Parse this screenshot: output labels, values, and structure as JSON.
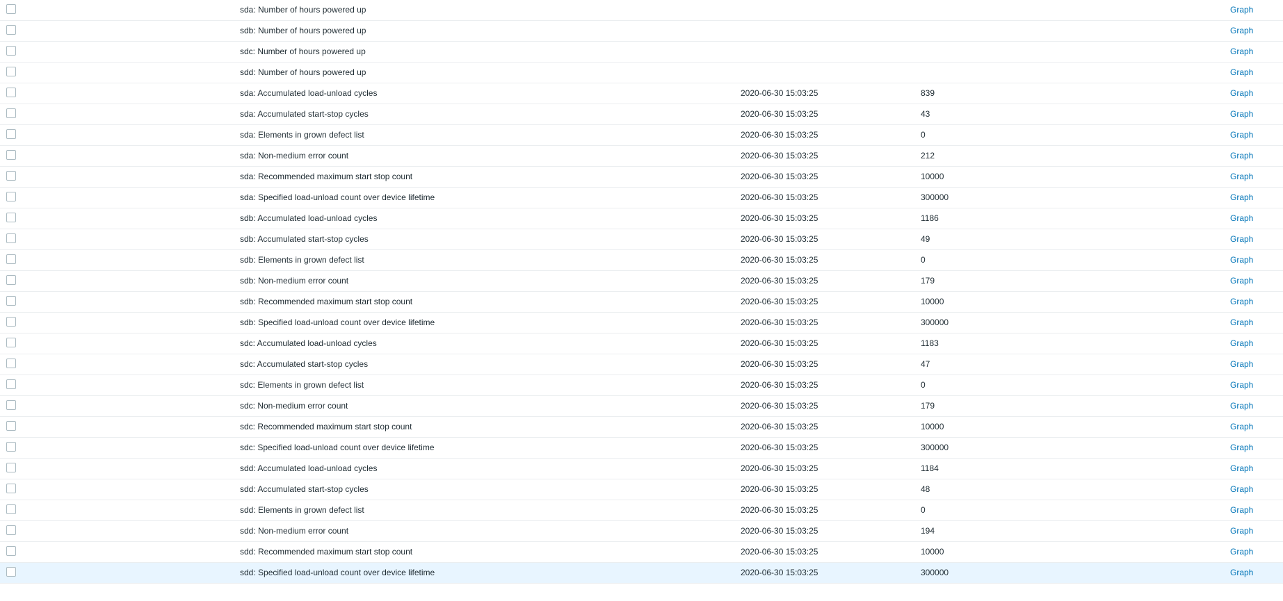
{
  "colors": {
    "link": "#0275b8",
    "row_border": "#ebeef0",
    "highlight_row": "#e8f5ff",
    "checkbox_border": "#acbbc2"
  },
  "rows": [
    {
      "name": "sda: Number of hours powered up",
      "last_check": "",
      "last_value": "",
      "action": "Graph"
    },
    {
      "name": "sdb: Number of hours powered up",
      "last_check": "",
      "last_value": "",
      "action": "Graph"
    },
    {
      "name": "sdc: Number of hours powered up",
      "last_check": "",
      "last_value": "",
      "action": "Graph"
    },
    {
      "name": "sdd: Number of hours powered up",
      "last_check": "",
      "last_value": "",
      "action": "Graph"
    },
    {
      "name": "sda: Accumulated load-unload cycles",
      "last_check": "2020-06-30 15:03:25",
      "last_value": "839",
      "action": "Graph"
    },
    {
      "name": "sda: Accumulated start-stop cycles",
      "last_check": "2020-06-30 15:03:25",
      "last_value": "43",
      "action": "Graph"
    },
    {
      "name": "sda: Elements in grown defect list",
      "last_check": "2020-06-30 15:03:25",
      "last_value": "0",
      "action": "Graph"
    },
    {
      "name": "sda: Non-medium error count",
      "last_check": "2020-06-30 15:03:25",
      "last_value": "212",
      "action": "Graph"
    },
    {
      "name": "sda: Recommended maximum start stop count",
      "last_check": "2020-06-30 15:03:25",
      "last_value": "10000",
      "action": "Graph"
    },
    {
      "name": "sda: Specified load-unload count over device lifetime",
      "last_check": "2020-06-30 15:03:25",
      "last_value": "300000",
      "action": "Graph"
    },
    {
      "name": "sdb: Accumulated load-unload cycles",
      "last_check": "2020-06-30 15:03:25",
      "last_value": "1186",
      "action": "Graph"
    },
    {
      "name": "sdb: Accumulated start-stop cycles",
      "last_check": "2020-06-30 15:03:25",
      "last_value": "49",
      "action": "Graph"
    },
    {
      "name": "sdb: Elements in grown defect list",
      "last_check": "2020-06-30 15:03:25",
      "last_value": "0",
      "action": "Graph"
    },
    {
      "name": "sdb: Non-medium error count",
      "last_check": "2020-06-30 15:03:25",
      "last_value": "179",
      "action": "Graph"
    },
    {
      "name": "sdb: Recommended maximum start stop count",
      "last_check": "2020-06-30 15:03:25",
      "last_value": "10000",
      "action": "Graph"
    },
    {
      "name": "sdb: Specified load-unload count over device lifetime",
      "last_check": "2020-06-30 15:03:25",
      "last_value": "300000",
      "action": "Graph"
    },
    {
      "name": "sdc: Accumulated load-unload cycles",
      "last_check": "2020-06-30 15:03:25",
      "last_value": "1183",
      "action": "Graph"
    },
    {
      "name": "sdc: Accumulated start-stop cycles",
      "last_check": "2020-06-30 15:03:25",
      "last_value": "47",
      "action": "Graph"
    },
    {
      "name": "sdc: Elements in grown defect list",
      "last_check": "2020-06-30 15:03:25",
      "last_value": "0",
      "action": "Graph"
    },
    {
      "name": "sdc: Non-medium error count",
      "last_check": "2020-06-30 15:03:25",
      "last_value": "179",
      "action": "Graph"
    },
    {
      "name": "sdc: Recommended maximum start stop count",
      "last_check": "2020-06-30 15:03:25",
      "last_value": "10000",
      "action": "Graph"
    },
    {
      "name": "sdc: Specified load-unload count over device lifetime",
      "last_check": "2020-06-30 15:03:25",
      "last_value": "300000",
      "action": "Graph"
    },
    {
      "name": "sdd: Accumulated load-unload cycles",
      "last_check": "2020-06-30 15:03:25",
      "last_value": "1184",
      "action": "Graph"
    },
    {
      "name": "sdd: Accumulated start-stop cycles",
      "last_check": "2020-06-30 15:03:25",
      "last_value": "48",
      "action": "Graph"
    },
    {
      "name": "sdd: Elements in grown defect list",
      "last_check": "2020-06-30 15:03:25",
      "last_value": "0",
      "action": "Graph"
    },
    {
      "name": "sdd: Non-medium error count",
      "last_check": "2020-06-30 15:03:25",
      "last_value": "194",
      "action": "Graph"
    },
    {
      "name": "sdd: Recommended maximum start stop count",
      "last_check": "2020-06-30 15:03:25",
      "last_value": "10000",
      "action": "Graph"
    },
    {
      "name": "sdd: Specified load-unload count over device lifetime",
      "last_check": "2020-06-30 15:03:25",
      "last_value": "300000",
      "action": "Graph",
      "highlighted": true
    }
  ]
}
